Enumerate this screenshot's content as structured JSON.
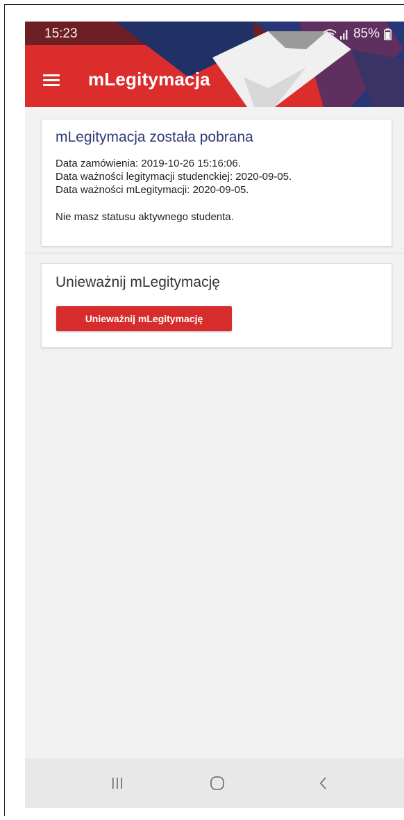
{
  "status_bar": {
    "time": "15:23",
    "battery_percent": "85%",
    "icons": [
      "wifi-icon",
      "signal-icon",
      "battery-icon"
    ]
  },
  "app_bar": {
    "title": "mLegitymacja",
    "menu_icon": "hamburger-menu-icon"
  },
  "status_card": {
    "title": "mLegitymacja została pobrana",
    "lines": [
      "Data zamówienia: 2019-10-26 15:16:06.",
      "Data ważności legitymacji studenckiej: 2020-09-05.",
      "Data ważności mLegitymacji: 2020-09-05.",
      "Nie masz statusu aktywnego studenta."
    ]
  },
  "revoke_card": {
    "title": "Unieważnij mLegitymację",
    "button_label": "Unieważnij mLegitymację"
  },
  "nav_bar": {
    "buttons": [
      "recent-apps-icon",
      "home-icon",
      "back-icon"
    ]
  },
  "colors": {
    "accent_red": "#dc2d2d",
    "title_blue": "#2d3a78",
    "button_red": "#d62c2c"
  }
}
